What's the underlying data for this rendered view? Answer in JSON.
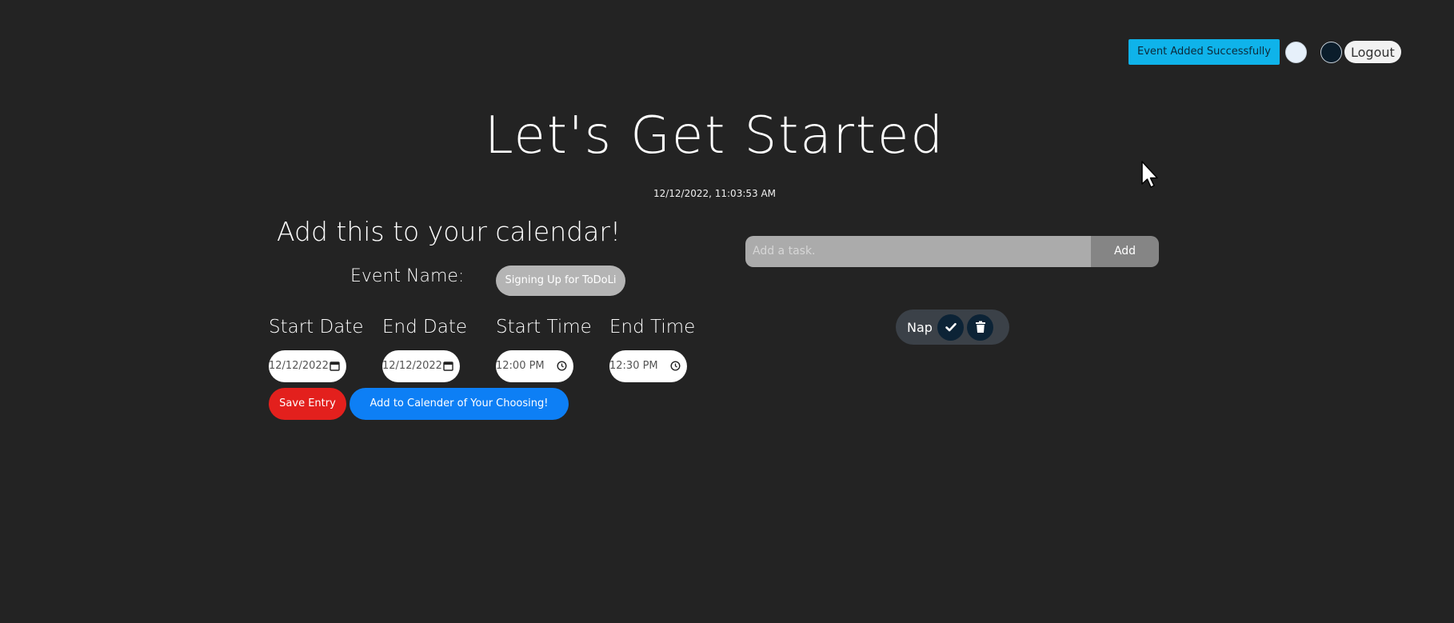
{
  "header": {
    "toast": "Event Added Successfully",
    "logout_label": "Logout"
  },
  "main": {
    "title": "Let's Get Started",
    "timestamp": "12/12/2022, 11:03:53 AM"
  },
  "calendar_form": {
    "heading": "Add this to your calendar!",
    "event_name_label": "Event Name:",
    "event_name_value": "Signing Up for ToDoLi",
    "fields": [
      {
        "label": "Start Date",
        "value": "12/12/2022",
        "icon": "calendar-icon"
      },
      {
        "label": "End Date",
        "value": "12/12/2022",
        "icon": "calendar-icon"
      },
      {
        "label": "Start Time",
        "value": "12:00 PM",
        "icon": "clock-icon"
      },
      {
        "label": "End Time",
        "value": "12:30 PM",
        "icon": "clock-icon"
      }
    ],
    "save_label": "Save Entry",
    "add_calendar_label": "Add to Calender of Your Choosing!"
  },
  "tasks": {
    "input_placeholder": "Add a task.",
    "add_label": "Add",
    "items": [
      {
        "name": "Nap"
      }
    ]
  },
  "colors": {
    "background": "#232323",
    "toast": "#0fb3ea",
    "save": "#e3201d",
    "calendar_button": "#0d7ff5",
    "task_item": "#3b4148"
  }
}
